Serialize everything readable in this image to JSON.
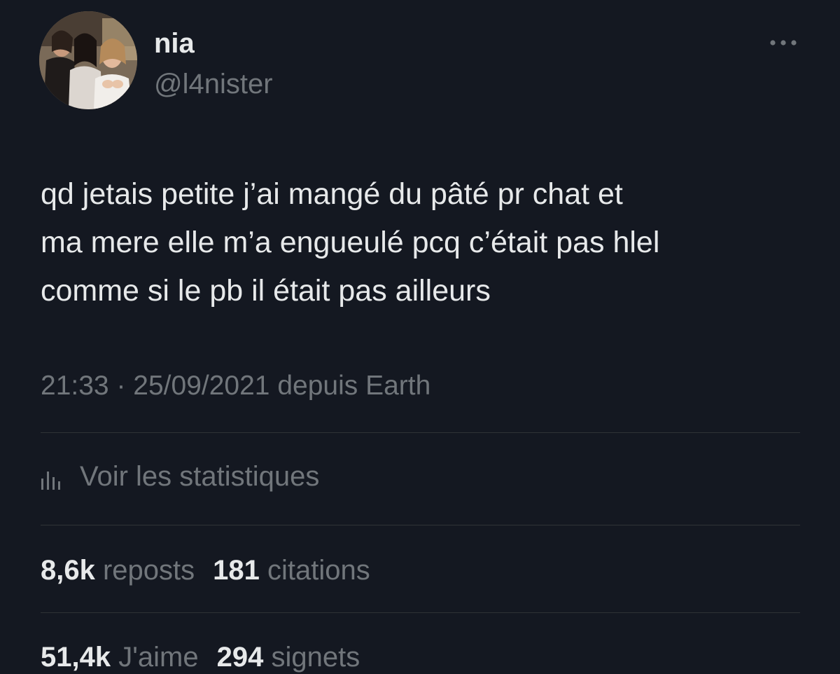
{
  "author": {
    "display_name": "nia",
    "handle": "@l4nister",
    "avatar": "profile-photo"
  },
  "menu": {
    "icon": "more-horizontal-icon"
  },
  "tweet": {
    "lines": [
      "qd jetais petite j’ai mangé du pâté pr chat et",
      "ma mere elle m’a engueulé pcq c’était pas hlel",
      "comme si le pb il était pas ailleurs"
    ]
  },
  "meta": {
    "time": "21:33",
    "separator": "·",
    "date": "25/09/2021",
    "source": "depuis Earth"
  },
  "stats_link": {
    "icon": "bar-chart-icon",
    "label": "Voir les statistiques"
  },
  "counts": {
    "reposts": {
      "value": "8,6k",
      "label": "reposts"
    },
    "quotes": {
      "value": "181",
      "label": "citations"
    },
    "likes": {
      "value": "51,4k",
      "label": "J'aime"
    },
    "bookmarks": {
      "value": "294",
      "label": "signets"
    }
  },
  "colors": {
    "background": "#141821",
    "primary_text": "#e7e9ea",
    "secondary_text": "#71767b",
    "divider": "#2f3336"
  }
}
